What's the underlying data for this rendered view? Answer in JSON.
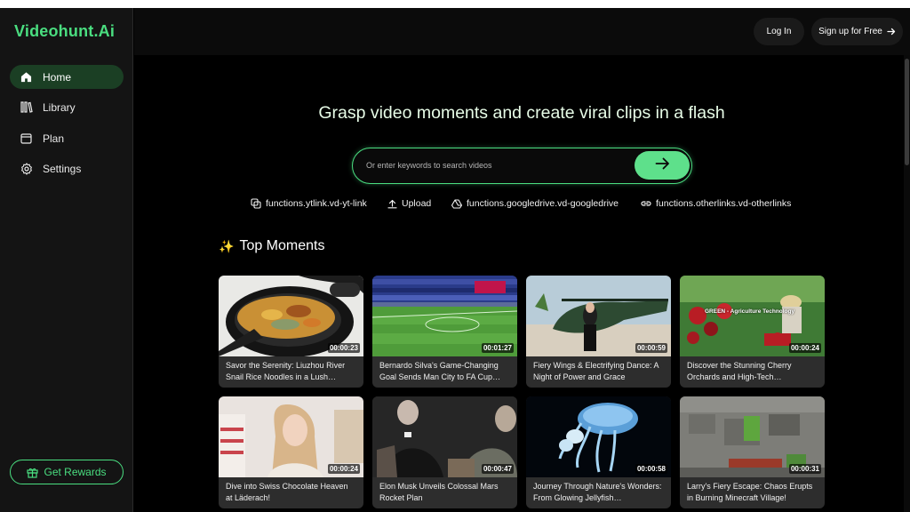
{
  "app": {
    "logo": "Videohunt.Ai",
    "accent": "#4ade80"
  },
  "sidebar": {
    "items": [
      {
        "label": "Home",
        "icon": "home-icon",
        "active": true
      },
      {
        "label": "Library",
        "icon": "library-icon",
        "active": false
      },
      {
        "label": "Plan",
        "icon": "plan-icon",
        "active": false
      },
      {
        "label": "Settings",
        "icon": "gear-icon",
        "active": false
      }
    ],
    "rewards_label": "Get Rewards",
    "rewards_icon": "gift-icon"
  },
  "header": {
    "login_label": "Log In",
    "signup_label": "Sign up for Free",
    "signup_icon": "arrow-right-icon"
  },
  "hero": {
    "title": "Grasp video moments and create viral clips in a flash",
    "search_placeholder": "Or enter keywords to search videos",
    "search_button_icon": "arrow-right-icon"
  },
  "sources": [
    {
      "label": "functions.ytlink.vd-yt-link",
      "icon": "copy-link-icon"
    },
    {
      "label": "Upload",
      "icon": "upload-icon"
    },
    {
      "label": "functions.googledrive.vd-googledrive",
      "icon": "google-drive-icon"
    },
    {
      "label": "functions.otherlinks.vd-otherlinks",
      "icon": "link-icon"
    }
  ],
  "section": {
    "title": "Top Moments",
    "icon": "sparkles-icon"
  },
  "videos": [
    {
      "duration": "00:00:23",
      "title": "Savor the Serenity: Liuzhou River Snail Rice Noodles in a Lush…"
    },
    {
      "duration": "00:01:27",
      "title": "Bernardo Silva's Game-Changing Goal Sends Man City to FA Cup…"
    },
    {
      "duration": "00:00:59",
      "title": "Fiery Wings & Electrifying Dance: A Night of Power and Grace"
    },
    {
      "duration": "00:00:24",
      "title": "Discover the Stunning Cherry Orchards and High-Tech…",
      "thumb_text": "GREEN - Agriculture Technology"
    },
    {
      "duration": "00:00:24",
      "title": "Dive into Swiss Chocolate Heaven at Läderach!"
    },
    {
      "duration": "00:00:47",
      "title": "Elon Musk Unveils Colossal Mars Rocket Plan"
    },
    {
      "duration": "00:00:58",
      "title": "Journey Through Nature's Wonders: From Glowing Jellyfish…"
    },
    {
      "duration": "00:00:31",
      "title": "Larry's Fiery Escape: Chaos Erupts in Burning Minecraft Village!"
    }
  ]
}
